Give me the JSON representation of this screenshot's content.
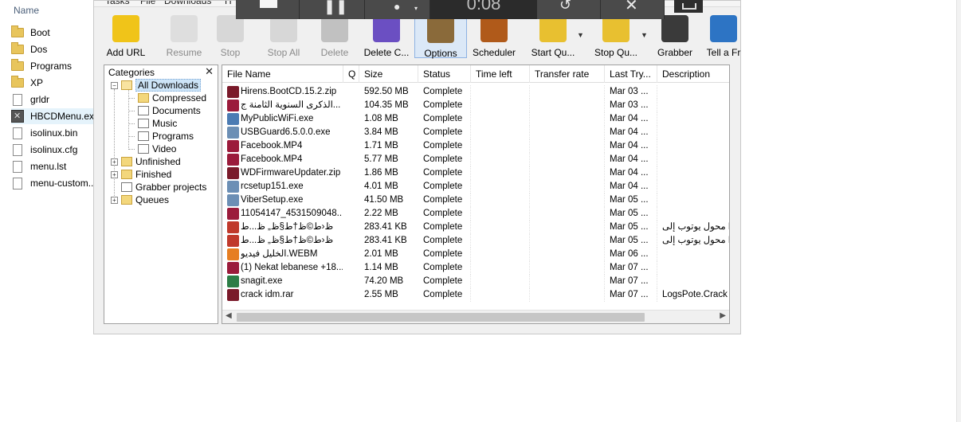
{
  "explorer": {
    "header": "Name",
    "items": [
      {
        "label": "Boot",
        "type": "folder"
      },
      {
        "label": "Dos",
        "type": "folder"
      },
      {
        "label": "Programs",
        "type": "folder"
      },
      {
        "label": "XP",
        "type": "folder"
      },
      {
        "label": "grldr",
        "type": "file"
      },
      {
        "label": "HBCDMenu.exe",
        "type": "app"
      },
      {
        "label": "isolinux.bin",
        "type": "file"
      },
      {
        "label": "isolinux.cfg",
        "type": "file"
      },
      {
        "label": "menu.lst",
        "type": "file"
      },
      {
        "label": "menu-custom...",
        "type": "file"
      }
    ]
  },
  "menu": [
    "Tasks",
    "File",
    "Downloads",
    "H"
  ],
  "toolbar": [
    {
      "label": "Add URL",
      "icon": "add-url-icon",
      "enabled": true
    },
    {
      "label": "Resume",
      "icon": "resume-icon",
      "enabled": false
    },
    {
      "label": "Stop",
      "icon": "stop-icon",
      "enabled": false
    },
    {
      "label": "Stop All",
      "icon": "stop-all-icon",
      "enabled": false
    },
    {
      "label": "Delete",
      "icon": "delete-icon",
      "enabled": false
    },
    {
      "label": "Delete C...",
      "icon": "delete-completed-icon",
      "enabled": true
    },
    {
      "label": "Options",
      "icon": "options-gear-icon",
      "enabled": true,
      "active": true
    },
    {
      "label": "Scheduler",
      "icon": "scheduler-clock-icon",
      "enabled": true
    },
    {
      "label": "Start Qu...",
      "icon": "start-queue-icon",
      "enabled": true
    },
    {
      "label": "Stop Qu...",
      "icon": "stop-queue-icon",
      "enabled": true
    },
    {
      "label": "Grabber",
      "icon": "grabber-icon",
      "enabled": true
    },
    {
      "label": "Tell a Fr",
      "icon": "tell-friend-icon",
      "enabled": true
    }
  ],
  "categories": {
    "title": "Categories",
    "close": "✕",
    "nodes": [
      {
        "label": "All Downloads",
        "expander": "−"
      },
      {
        "label": "Compressed"
      },
      {
        "label": "Documents"
      },
      {
        "label": "Music"
      },
      {
        "label": "Programs"
      },
      {
        "label": "Video"
      },
      {
        "label": "Unfinished",
        "expander": "+"
      },
      {
        "label": "Finished",
        "expander": "+"
      },
      {
        "label": "Grabber projects"
      },
      {
        "label": "Queues",
        "expander": "+"
      }
    ]
  },
  "list": {
    "columns": [
      "File Name",
      "Q",
      "Size",
      "Status",
      "Time left",
      "Transfer rate",
      "Last Try...",
      "Description"
    ],
    "rows": [
      {
        "name": "Hirens.BootCD.15.2.zip",
        "size": "592.50  MB",
        "status": "Complete",
        "last": "Mar 03 ...",
        "desc": "",
        "icon": "#7a1a2a"
      },
      {
        "name": "الذكرى السنوية الثامنة ج...",
        "size": "104.35  MB",
        "status": "Complete",
        "last": "Mar 03 ...",
        "desc": "",
        "icon": "#9b1b3b"
      },
      {
        "name": "MyPublicWiFi.exe",
        "size": "1.08  MB",
        "status": "Complete",
        "last": "Mar 04 ...",
        "desc": "",
        "icon": "#4b7bb3"
      },
      {
        "name": "USBGuard6.5.0.0.exe",
        "size": "3.84  MB",
        "status": "Complete",
        "last": "Mar 04 ...",
        "desc": "",
        "icon": "#6c8fb5"
      },
      {
        "name": "Facebook.MP4",
        "size": "1.71  MB",
        "status": "Complete",
        "last": "Mar 04 ...",
        "desc": "",
        "icon": "#9b1b3b"
      },
      {
        "name": "Facebook.MP4",
        "size": "5.77  MB",
        "status": "Complete",
        "last": "Mar 04 ...",
        "desc": "",
        "icon": "#9b1b3b"
      },
      {
        "name": "WDFirmwareUpdater.zip",
        "size": "1.86  MB",
        "status": "Complete",
        "last": "Mar 04 ...",
        "desc": "",
        "icon": "#7a1a2a"
      },
      {
        "name": "rcsetup151.exe",
        "size": "4.01  MB",
        "status": "Complete",
        "last": "Mar 04 ...",
        "desc": "",
        "icon": "#6c8fb5"
      },
      {
        "name": "ViberSetup.exe",
        "size": "41.50  MB",
        "status": "Complete",
        "last": "Mar 05 ...",
        "desc": "",
        "icon": "#6c8fb5"
      },
      {
        "name": "11054147_4531509048...",
        "size": "2.22  MB",
        "status": "Complete",
        "last": "Mar 05 ...",
        "desc": "",
        "icon": "#9b1b3b"
      },
      {
        "name": "ظ‹ط©ظ†ط§ظ„ ظ...ط",
        "size": "283.41  KB",
        "status": "Complete",
        "last": "Mar 05 ...",
        "desc": "محول يوتوب إلى M",
        "icon": "#c0392b"
      },
      {
        "name": "ظ‹ط©ظ†ط§ظ„ ظ...ط",
        "size": "283.41  KB",
        "status": "Complete",
        "last": "Mar 05 ...",
        "desc": "محول يوتوب إلى M",
        "icon": "#c0392b"
      },
      {
        "name": "الخليل فيديو.WEBM",
        "size": "2.01  MB",
        "status": "Complete",
        "last": "Mar 06 ...",
        "desc": "",
        "icon": "#e67e22"
      },
      {
        "name": "(1) Nekat lebanese +18...",
        "size": "1.14  MB",
        "status": "Complete",
        "last": "Mar 07 ...",
        "desc": "",
        "icon": "#9b1b3b"
      },
      {
        "name": "snagit.exe",
        "size": "74.20  MB",
        "status": "Complete",
        "last": "Mar 07 ...",
        "desc": "",
        "icon": "#2d7d46"
      },
      {
        "name": "crack idm.rar",
        "size": "2.55  MB",
        "status": "Complete",
        "last": "Mar 07 ...",
        "desc": "LogsPote.Crack ذ",
        "icon": "#7a1a2a"
      }
    ]
  },
  "recorder": {
    "timer": "0:08"
  }
}
